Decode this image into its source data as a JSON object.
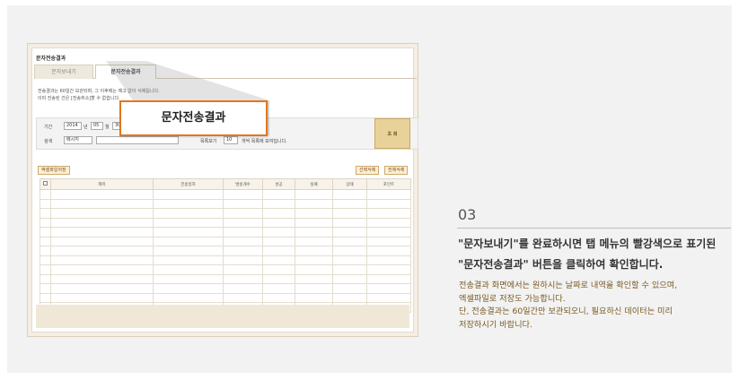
{
  "window": {
    "title": "문자전송결과"
  },
  "tabs": [
    {
      "label": "문자보내기"
    },
    {
      "label": "문자전송결과"
    }
  ],
  "notice": {
    "line1": "전송결과는 60일간 보관되며, 그 이후에는 예고 없이 삭제됩니다.",
    "line2": "이미 전송된 건은 [전송취소]할 수 없습니다."
  },
  "search": {
    "period_label": "기간",
    "year": "2014",
    "year_unit": "년",
    "month": "05",
    "month_unit": "월",
    "day": "30",
    "type_label": "검색",
    "type_value": "메시지",
    "per_page_value": "10",
    "per_page_note": "목록보기",
    "per_page_suffix": "개씩 목록에 보여집니다.",
    "button_label": "조 회"
  },
  "actions": {
    "excel_save": "엑셀파일저장",
    "delete_selected": "선택삭제",
    "delete_all": "전체삭제"
  },
  "table": {
    "headers": [
      "제목",
      "전송일자",
      "발송개수",
      "성공",
      "실패",
      "상태",
      "포인트"
    ],
    "empty_rows": 13
  },
  "callout": {
    "label": "문자전송결과"
  },
  "guide": {
    "step": "03",
    "heading_line1": "\"문자보내기\"를 완료하시면 탭 메뉴의 빨강색으로 표기된",
    "heading_line2": "\"문자전송결과\" 버튼을 클릭하여 확인합니다.",
    "desc_line1": "전송결과 화면에서는 원하시는 날짜로 내역을 확인할 수 있으며,",
    "desc_line2": "엑셀파일로 저장도 가능합니다.",
    "desc_line3": "단, 전송결과는 60일간만 보관되오니, 필요하신 데이터는 미리",
    "desc_line4": "저장하시기 바랍니다."
  },
  "colors": {
    "callout_border": "#e0781e",
    "accent_text": "#7a5a22",
    "search_button": "#e9d29a"
  }
}
